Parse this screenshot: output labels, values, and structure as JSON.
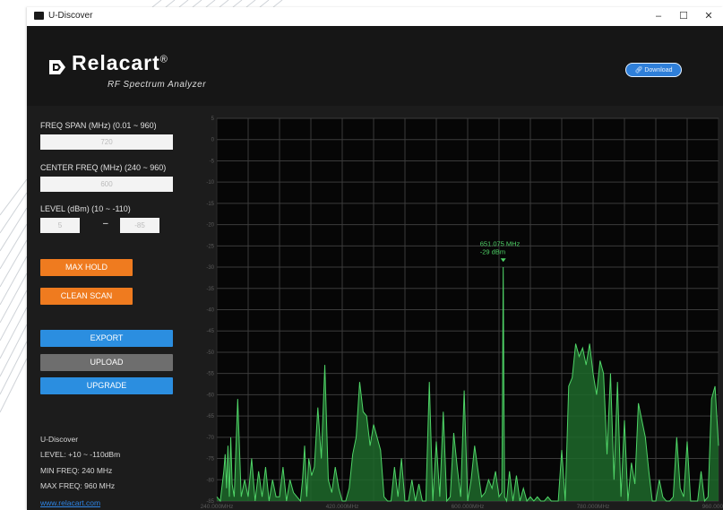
{
  "window": {
    "title": "U-Discover",
    "min_glyph": "–",
    "max_glyph": "☐",
    "close_glyph": "✕"
  },
  "header": {
    "brand": "Relacart",
    "registered": "®",
    "subtitle": "RF Spectrum Analyzer",
    "download_label": "Download"
  },
  "sidebar": {
    "freq_span_label": "FREQ SPAN (MHz) (0.01 ~ 960)",
    "freq_span_value": "720",
    "center_freq_label": "CENTER FREQ (MHz) (240 ~ 960)",
    "center_freq_value": "600",
    "level_label": "LEVEL (dBm) (10 ~ -110)",
    "level_high_value": "5",
    "level_low_value": "-85",
    "level_separator": "–",
    "max_hold_label": "MAX HOLD",
    "clean_scan_label": "CLEAN SCAN",
    "export_label": "EXPORT",
    "upload_label": "UPLOAD",
    "upgrade_label": "UPGRADE",
    "info": [
      "U-Discover",
      "LEVEL: +10 ~ -110dBm",
      "MIN FREQ: 240 MHz",
      "MAX FREQ: 960 MHz"
    ],
    "website": "www.relacart.com"
  },
  "colors": {
    "accent_orange": "#ef7b1f",
    "accent_blue": "#2b8ee0",
    "trace_green": "#4fd467"
  },
  "chart_data": {
    "type": "area",
    "title": "",
    "xlabel": "",
    "ylabel": "",
    "xlim": [
      240,
      960
    ],
    "ylim": [
      -85,
      5
    ],
    "grid": true,
    "x_ticks": [
      240,
      420,
      600,
      780,
      960
    ],
    "x_tick_labels": [
      "240.000MHz",
      "420.000MHz",
      "600.000MHz",
      "780.000MHz",
      "960.000MHz"
    ],
    "y_ticks": [
      5,
      0,
      -5,
      -10,
      -15,
      -20,
      -25,
      -30,
      -35,
      -40,
      -45,
      -50,
      -55,
      -60,
      -65,
      -70,
      -75,
      -80,
      -85
    ],
    "marker": {
      "x": 651.075,
      "y": -29,
      "label": "651.075 MHz",
      "sublabel": "-29 dBm"
    },
    "x": [
      240,
      245,
      250,
      252,
      254,
      256,
      258,
      260,
      262,
      265,
      270,
      275,
      280,
      285,
      290,
      295,
      300,
      305,
      310,
      315,
      320,
      325,
      330,
      335,
      340,
      345,
      350,
      355,
      360,
      363,
      366,
      369,
      372,
      376,
      380,
      385,
      390,
      395,
      400,
      405,
      410,
      415,
      420,
      425,
      430,
      435,
      440,
      445,
      450,
      455,
      460,
      465,
      470,
      475,
      480,
      485,
      490,
      495,
      500,
      505,
      510,
      515,
      520,
      525,
      530,
      535,
      540,
      545,
      550,
      555,
      560,
      565,
      570,
      575,
      580,
      585,
      590,
      595,
      600,
      605,
      610,
      615,
      620,
      625,
      630,
      635,
      640,
      645,
      649,
      650,
      651,
      652,
      653,
      656,
      660,
      665,
      670,
      675,
      680,
      685,
      690,
      695,
      700,
      705,
      710,
      715,
      720,
      725,
      730,
      735,
      740,
      745,
      750,
      755,
      760,
      765,
      770,
      775,
      780,
      785,
      790,
      795,
      800,
      805,
      810,
      815,
      820,
      825,
      830,
      835,
      840,
      845,
      850,
      855,
      860,
      865,
      870,
      875,
      880,
      885,
      890,
      895,
      900,
      905,
      910,
      915,
      920,
      925,
      930,
      935,
      940,
      945,
      950,
      955,
      960
    ],
    "y": [
      -84,
      -85,
      -78,
      -74,
      -82,
      -72,
      -84,
      -70,
      -81,
      -84,
      -61,
      -84,
      -80,
      -84,
      -75,
      -85,
      -78,
      -84,
      -77,
      -85,
      -80,
      -84,
      -84,
      -77,
      -85,
      -80,
      -83,
      -84,
      -85,
      -80,
      -72,
      -84,
      -75,
      -79,
      -77,
      -63,
      -75,
      -53,
      -80,
      -83,
      -77,
      -82,
      -85,
      -85,
      -82,
      -74,
      -70,
      -57,
      -64,
      -65,
      -72,
      -67,
      -70,
      -73,
      -84,
      -85,
      -85,
      -77,
      -84,
      -75,
      -85,
      -85,
      -80,
      -85,
      -81,
      -85,
      -85,
      -57,
      -85,
      -71,
      -84,
      -64,
      -85,
      -84,
      -69,
      -77,
      -84,
      -59,
      -85,
      -80,
      -72,
      -78,
      -84,
      -83,
      -80,
      -82,
      -78,
      -84,
      -83,
      -60,
      -30,
      -60,
      -84,
      -85,
      -78,
      -85,
      -79,
      -85,
      -82,
      -85,
      -84,
      -85,
      -84,
      -85,
      -85,
      -84,
      -85,
      -85,
      -85,
      -73,
      -85,
      -58,
      -56,
      -48,
      -51,
      -49,
      -53,
      -48,
      -55,
      -60,
      -52,
      -55,
      -74,
      -55,
      -80,
      -57,
      -84,
      -66,
      -85,
      -76,
      -81,
      -62,
      -66,
      -70,
      -78,
      -85,
      -85,
      -80,
      -84,
      -85,
      -85,
      -84,
      -70,
      -82,
      -84,
      -71,
      -85,
      -85,
      -85,
      -78,
      -85,
      -84,
      -61,
      -58,
      -72
    ]
  }
}
